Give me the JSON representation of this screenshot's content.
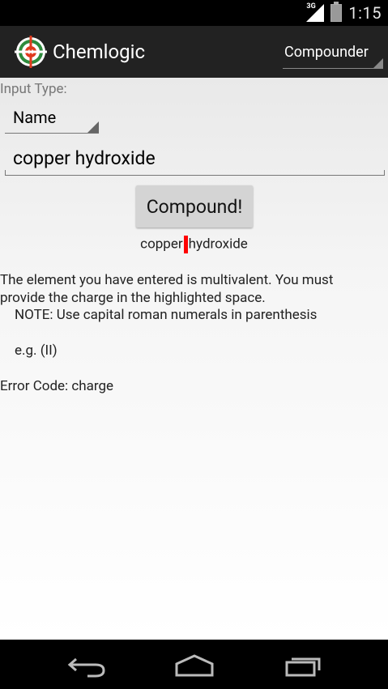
{
  "status_bar": {
    "network": "3G",
    "time": "1:15"
  },
  "action_bar": {
    "title": "Chemlogic",
    "mode_spinner": "Compounder"
  },
  "form": {
    "input_type_label": "Input Type:",
    "input_type_value": "Name",
    "input_value": "copper hydroxide",
    "button_label": "Compound!"
  },
  "result": {
    "preview_before": "copper",
    "preview_after": "hydroxide",
    "message": "The element you have entered is multivalent. You must provide the charge in the highlighted space.",
    "note": "NOTE: Use capital roman numerals in parenthesis",
    "example": "e.g. (II)",
    "error_code": "Error Code: charge"
  },
  "colors": {
    "highlight": "#ff0000",
    "action_bar": "#222222",
    "icon_ring": "#2e8b3d",
    "icon_accent": "#e03a1e"
  },
  "icons": {
    "app": "chemlogic-logo-icon",
    "back": "back-icon",
    "home": "home-icon",
    "recents": "recents-icon"
  }
}
